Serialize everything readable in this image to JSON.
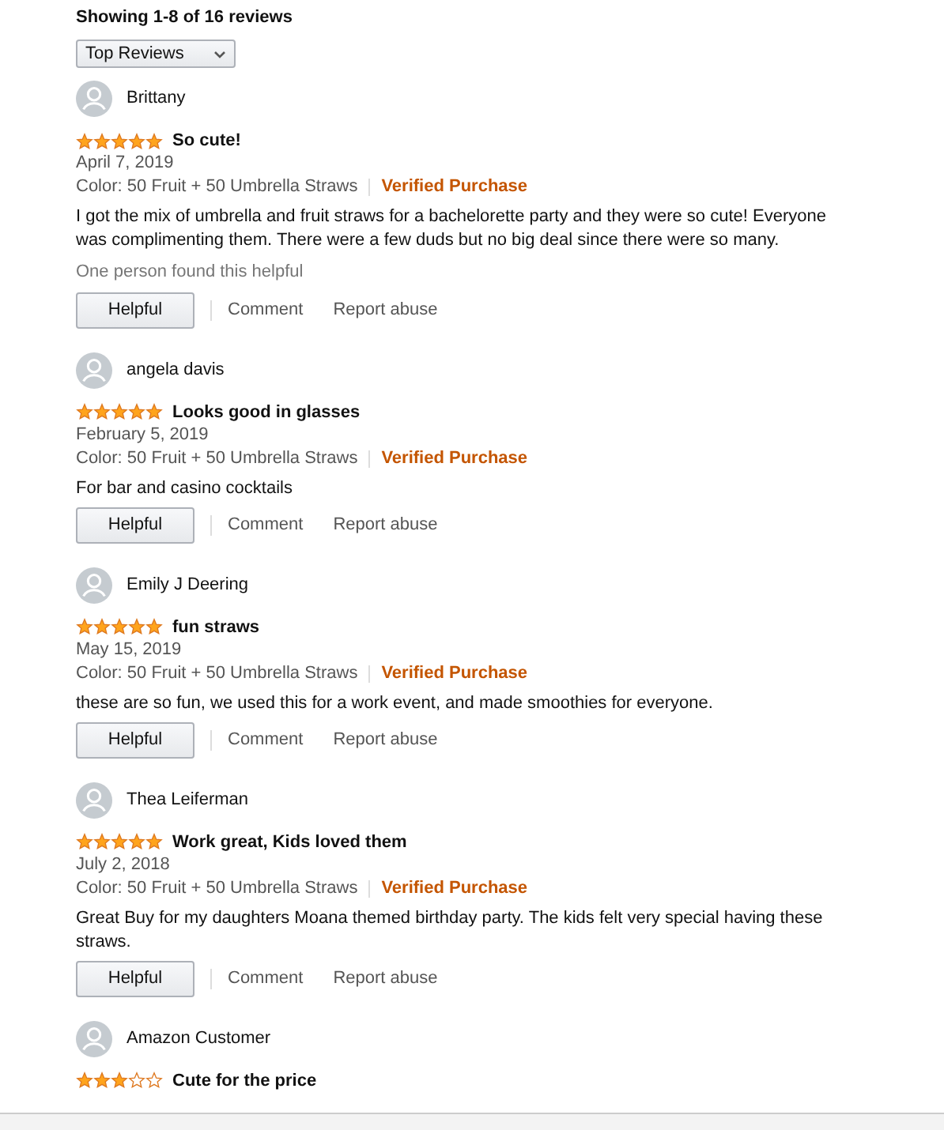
{
  "header": "Showing 1-8 of 16 reviews",
  "sort": {
    "value": "Top Reviews"
  },
  "reviews": [
    {
      "name": "Brittany",
      "stars": 5,
      "title": "So cute!",
      "date": "April 7, 2019",
      "variant": "Color: 50 Fruit + 50 Umbrella Straws",
      "verified": "Verified Purchase",
      "body": "I got the mix of umbrella and fruit straws for a bachelorette party and they were so cute! Everyone was complimenting them. There were a few duds but no big deal since there were so many.",
      "helpful_note": "One person found this helpful",
      "actions": [
        "Helpful",
        "Comment",
        "Report abuse"
      ]
    },
    {
      "name": "angela davis",
      "stars": 5,
      "title": "Looks good in glasses",
      "date": "February 5, 2019",
      "variant": "Color: 50 Fruit + 50 Umbrella Straws",
      "verified": "Verified Purchase",
      "body": "For bar and casino cocktails",
      "actions": [
        "Helpful",
        "Comment",
        "Report abuse"
      ]
    },
    {
      "name": "Emily J Deering",
      "stars": 5,
      "title": "fun straws",
      "date": "May 15, 2019",
      "variant": "Color: 50 Fruit + 50 Umbrella Straws",
      "verified": "Verified Purchase",
      "body": "these are so fun, we used this for a work event, and made smoothies for everyone.",
      "actions": [
        "Helpful",
        "Comment",
        "Report abuse"
      ]
    },
    {
      "name": "Thea Leiferman",
      "stars": 5,
      "title": "Work great, Kids loved them",
      "date": "July 2, 2018",
      "variant": "Color: 50 Fruit + 50 Umbrella Straws",
      "verified": "Verified Purchase",
      "body": "Great Buy for my daughters Moana themed birthday party. The kids felt very special having these straws.",
      "actions": [
        "Helpful",
        "Comment",
        "Report abuse"
      ]
    },
    {
      "name": "Amazon Customer",
      "stars": 3,
      "title": "Cute for the price"
    }
  ]
}
